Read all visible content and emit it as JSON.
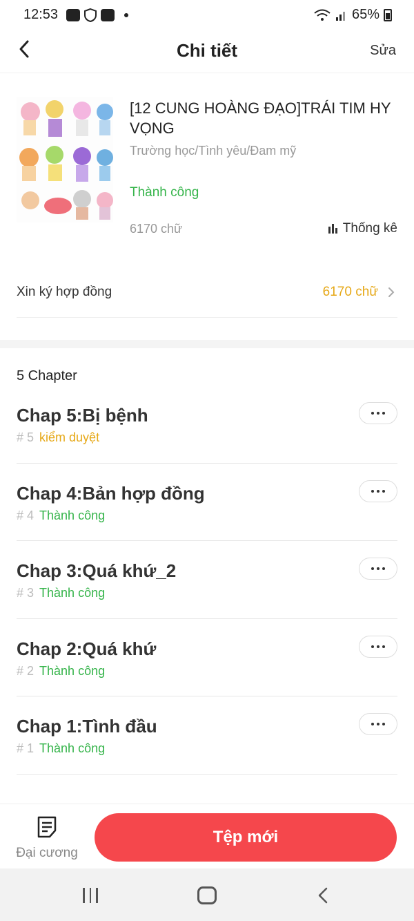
{
  "status_bar": {
    "time": "12:53",
    "battery": "65%"
  },
  "header": {
    "title": "Chi tiết",
    "edit_label": "Sửa"
  },
  "book": {
    "title": "[12 CUNG HOÀNG ĐẠO]TRÁI TIM HY VỌNG",
    "genre": "Trường học/Tình yêu/Đam mỹ",
    "status": "Thành công",
    "word_count": "6170 chữ",
    "stats_label": "Thống kê"
  },
  "contract": {
    "label": "Xin ký hợp đồng",
    "value": "6170 chữ"
  },
  "chapter_count": "5 Chapter",
  "chapters": [
    {
      "title": "Chap 5:Bị bệnh",
      "number": "# 5",
      "status": "kiểm duyệt"
    },
    {
      "title": "Chap 4:Bản hợp đồng",
      "number": "# 4",
      "status": "Thành công"
    },
    {
      "title": "Chap 3:Quá khứ_2",
      "number": "# 3",
      "status": "Thành công"
    },
    {
      "title": "Chap 2:Quá khứ",
      "number": "# 2",
      "status": "Thành công"
    },
    {
      "title": "Chap 1:Tình đầu",
      "number": "# 1",
      "status": "Thành công"
    }
  ],
  "bottom": {
    "outline_label": "Đại cương",
    "new_file_label": "Tệp mới"
  },
  "colors": {
    "accent": "#f5474c",
    "success": "#35b44a",
    "pending": "#e6a817"
  }
}
